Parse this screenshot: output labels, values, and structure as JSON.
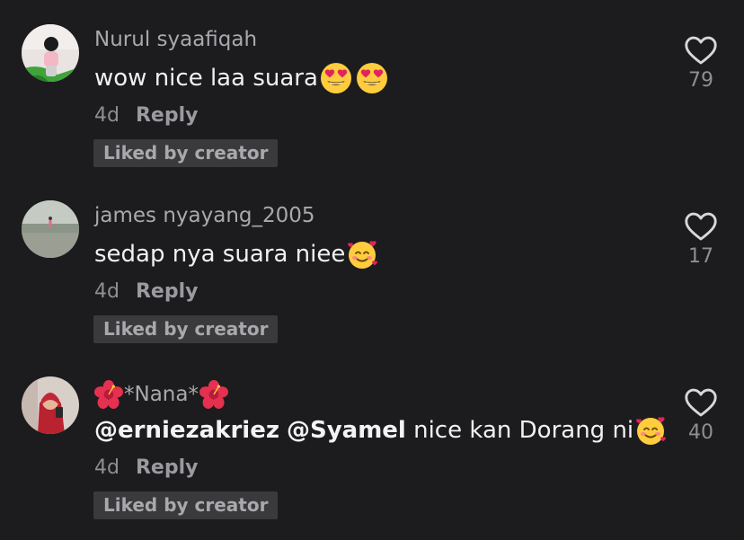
{
  "comments": [
    {
      "username": "Nurul syaafiqah",
      "text": "wow nice laa suara",
      "time": "4d",
      "reply_label": "Reply",
      "badge": "Liked by creator",
      "likes": "79"
    },
    {
      "username": "james nyayang_2005",
      "text": "sedap nya suara niee",
      "time": "4d",
      "reply_label": "Reply",
      "badge": "Liked by creator",
      "likes": "17"
    },
    {
      "username": "*Nana*",
      "mentions": [
        "@erniezakriez",
        "@Syamel"
      ],
      "text": " nice kan Dorang ni",
      "time": "4d",
      "reply_label": "Reply",
      "badge": "Liked by creator",
      "likes": "40"
    }
  ],
  "icons": {
    "like": "heart-outline-icon",
    "emoji_heart_eyes": "heart-eyes-emoji",
    "emoji_hearts_face": "smiling-face-with-hearts-emoji",
    "emoji_flower": "hibiscus-emoji"
  },
  "colors": {
    "background": "#1c1c1e",
    "username": "#a9a9ad",
    "text": "#f0f0f0",
    "badge_bg": "#3a3a3c"
  }
}
